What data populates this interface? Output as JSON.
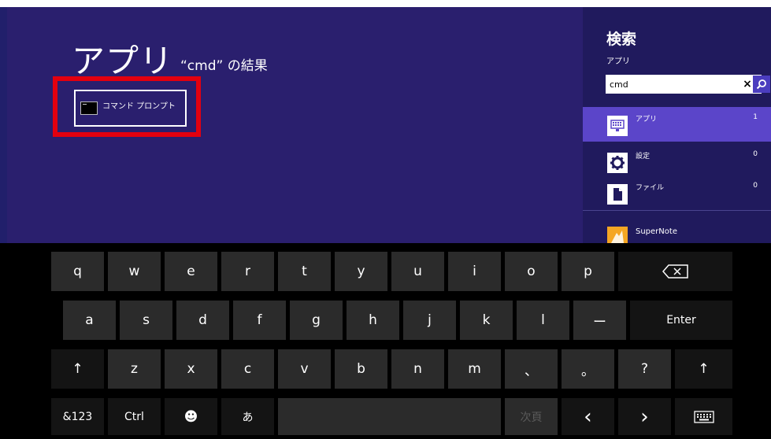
{
  "main": {
    "title": "アプリ",
    "query_label": "“cmd” の結果",
    "results": [
      {
        "label": "コマンド プロンプト",
        "icon": "command-prompt-icon"
      }
    ]
  },
  "charm": {
    "title": "検索",
    "scope": "アプリ",
    "search_value": "cmd",
    "categories": [
      {
        "label": "アプリ",
        "count": "1",
        "icon": "apps-icon",
        "selected": true
      },
      {
        "label": "設定",
        "count": "0",
        "icon": "settings-gear-icon",
        "selected": false
      },
      {
        "label": "ファイル",
        "count": "0",
        "icon": "file-icon",
        "selected": false
      }
    ],
    "app_item": {
      "label": "SuperNote",
      "icon": "supernote-app-icon"
    }
  },
  "keyboard": {
    "row1": [
      "q",
      "w",
      "e",
      "r",
      "t",
      "y",
      "u",
      "i",
      "o",
      "p"
    ],
    "backspace_icon": "backspace-icon",
    "row2": [
      "a",
      "s",
      "d",
      "f",
      "g",
      "h",
      "j",
      "k",
      "l",
      "ー"
    ],
    "enter_label": "Enter",
    "row3": [
      "z",
      "x",
      "c",
      "v",
      "b",
      "n",
      "m",
      "、",
      "。",
      "?"
    ],
    "shift_glyph": "↑",
    "row4": {
      "sym_label": "&123",
      "ctrl_label": "Ctrl",
      "emoji_glyph": "☻",
      "kana_label": "あ",
      "next_label": "次頁",
      "left_glyph": "‹",
      "right_glyph": "›",
      "keyboard_icon": "keyboard-layout-icon"
    }
  },
  "colors": {
    "background": "#2a1f6e",
    "charm_background": "#201a5d",
    "selected_category": "#5b45c9",
    "highlight": "#e3000f",
    "key": "#2b2b2b"
  }
}
